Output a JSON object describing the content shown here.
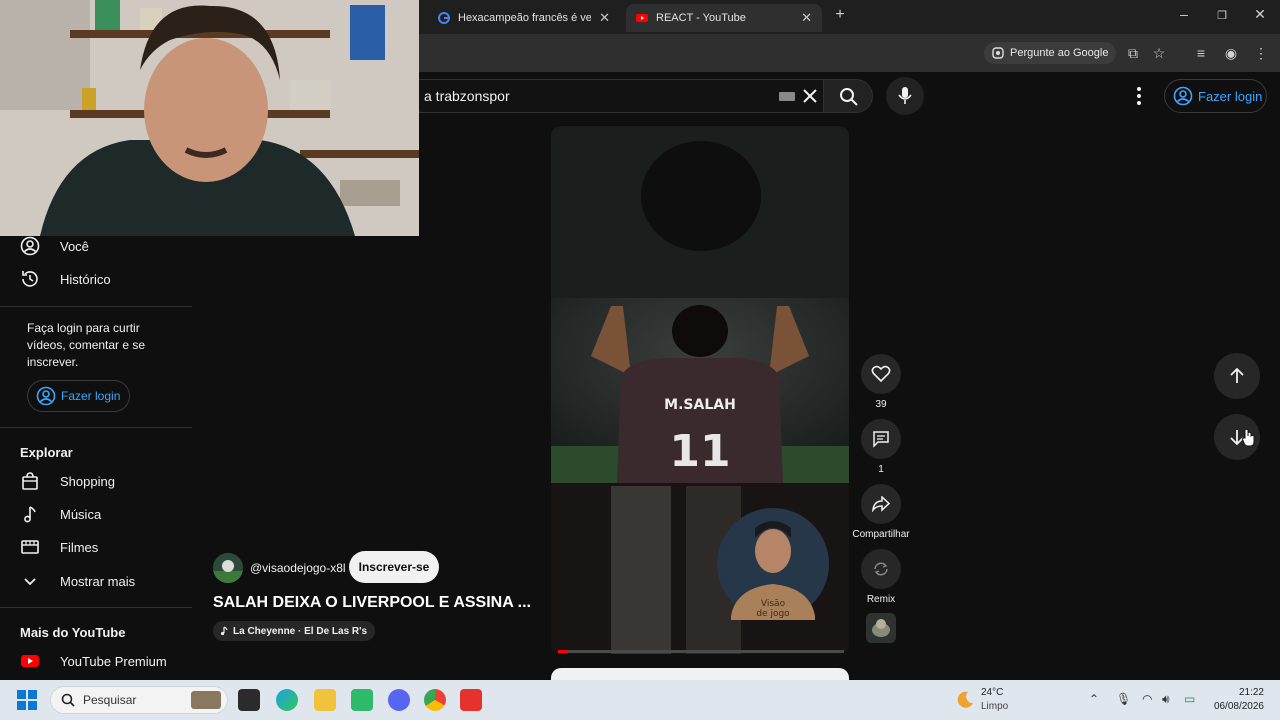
{
  "browser": {
    "tabs": [
      {
        "title": "Hexacampeão francês é vendid",
        "icon": "google-icon"
      },
      {
        "title": "REACT - YouTube",
        "icon": "youtube-icon"
      }
    ],
    "ask_google": "Pergunte ao Google"
  },
  "header": {
    "search_value": "a trabzonspor",
    "login_label": "Fazer login"
  },
  "sidebar": {
    "items": [
      {
        "label": "Você",
        "icon": "person-icon"
      },
      {
        "label": "Histórico",
        "icon": "history-icon"
      }
    ],
    "login_message": "Faça login para curtir vídeos, comentar e se inscrever.",
    "login_label": "Fazer login",
    "explore_heading": "Explorar",
    "explore_items": [
      {
        "label": "Shopping",
        "icon": "shopping-bag-icon"
      },
      {
        "label": "Música",
        "icon": "music-note-icon"
      },
      {
        "label": "Filmes",
        "icon": "film-icon"
      },
      {
        "label": "Mostrar mais",
        "icon": "chevron-down-icon"
      }
    ],
    "more_heading": "Mais do YouTube",
    "more_items": [
      {
        "label": "YouTube Premium",
        "icon": "youtube-premium-icon"
      }
    ]
  },
  "short": {
    "channel": "@visaodejogo-x8l",
    "subscribe": "Inscrever-se",
    "title": "SALAH DEIXA O LIVERPOOL E ASSINA ...",
    "music": "La Cheyenne · El De Las R's",
    "jersey_name": "M.SALAH",
    "jersey_number": "11",
    "badge_text_1": "Visão",
    "badge_text_2": "de jogo",
    "progress": 0.03,
    "actions": {
      "likes": "39",
      "comments": "1",
      "share": "Compartilhar",
      "remix": "Remix"
    }
  },
  "taskbar": {
    "search_placeholder": "Pesquisar",
    "weather_temp": "24°C",
    "weather_desc": "Limpo",
    "time": "21:22",
    "date": "06/08/2026"
  },
  "colors": {
    "accent_blue": "#3ea6ff",
    "youtube_red": "#ff0000",
    "background": "#0f0f0f"
  }
}
